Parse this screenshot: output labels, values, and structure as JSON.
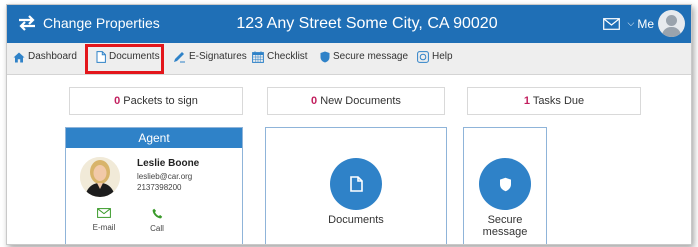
{
  "header": {
    "app_label": "Change Properties",
    "address": "123 Any Street Some City, CA 90020",
    "user_label": "Me",
    "icons": [
      "swap-arrows-icon",
      "mail-icon",
      "chevron-down-icon",
      "user-avatar-icon"
    ]
  },
  "nav": {
    "items": [
      {
        "label": "Dashboard",
        "icon": "home-icon"
      },
      {
        "label": "Documents",
        "icon": "document-icon"
      },
      {
        "label": "E-Signatures",
        "icon": "pen-icon"
      },
      {
        "label": "Checklist",
        "icon": "calendar-icon"
      },
      {
        "label": "Secure message",
        "icon": "shield-icon"
      },
      {
        "label": "Help",
        "icon": "help-icon"
      }
    ],
    "highlighted": "Documents"
  },
  "summary": [
    {
      "count": "0",
      "text": "Packets to sign"
    },
    {
      "count": "0",
      "text": "New Documents"
    },
    {
      "count": "1",
      "text": "Tasks Due"
    }
  ],
  "agent": {
    "title": "Agent",
    "name": "Leslie Boone",
    "email": "leslieb@car.org",
    "phone": "2137398200",
    "actions": [
      {
        "label": "E-mail",
        "icon": "mail-icon"
      },
      {
        "label": "Call",
        "icon": "phone-icon"
      }
    ]
  },
  "tiles": [
    {
      "label": "Documents",
      "icon": "document-icon"
    },
    {
      "label": "Secure message",
      "icon": "shield-icon"
    }
  ],
  "colors": {
    "header_blue": "#1f6fb6",
    "tile_blue": "#2f82c8",
    "count_magenta": "#c21f5e",
    "highlight_red": "#e3161b",
    "contact_green": "#3a9a2a"
  }
}
